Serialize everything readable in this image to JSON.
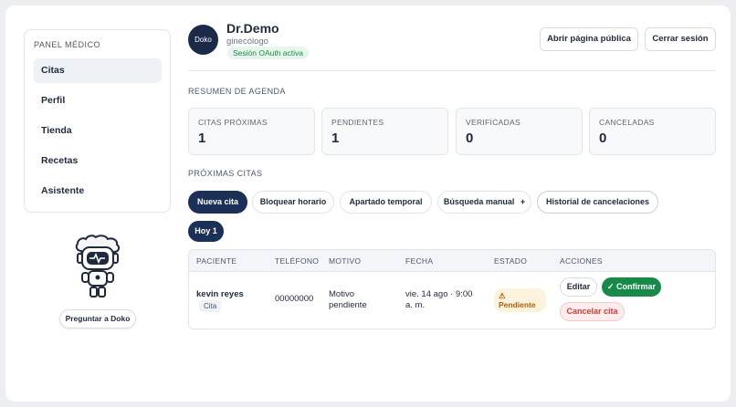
{
  "sidebar": {
    "title": "PANEL MÉDICO",
    "items": [
      {
        "label": "Citas",
        "active": true
      },
      {
        "label": "Perfil"
      },
      {
        "label": "Tienda"
      },
      {
        "label": "Recetas"
      },
      {
        "label": "Asistente"
      }
    ],
    "assistant_button": "Preguntar a Doko"
  },
  "header": {
    "avatar_text": "Doko",
    "doctor_name": "Dr.Demo",
    "specialty": "ginecólogo",
    "session_badge": "Sesión OAuth activa",
    "open_public_label": "Abrir página pública",
    "logout_label": "Cerrar sesión"
  },
  "summary": {
    "section_title": "RESUMEN DE AGENDA",
    "stats": [
      {
        "label": "CITAS PRÓXIMAS",
        "value": "1"
      },
      {
        "label": "PENDIENTES",
        "value": "1"
      },
      {
        "label": "VERIFICADAS",
        "value": "0"
      },
      {
        "label": "CANCELADAS",
        "value": "0"
      }
    ]
  },
  "upcoming": {
    "section_title": "PRÓXIMAS CITAS",
    "actions": {
      "new": "Nueva cita",
      "block": "Bloquear horario",
      "temp": "Apartado temporal",
      "search": "Búsqueda manual",
      "search_icon": "+",
      "history": "Historial de cancelaciones"
    },
    "filter_today": "Hoy 1",
    "table": {
      "headers": [
        "PACIENTE",
        "TELÉFONO",
        "MOTIVO",
        "FECHA",
        "ESTADO",
        "ACCIONES"
      ],
      "rows": [
        {
          "patient": "kevin reyes",
          "patient_tag": "Cita",
          "phone": "00000000",
          "reason_line1": "Motivo",
          "reason_line2": "pendiente",
          "date_line1": "vie. 14 ago · 9:00",
          "date_line2": "a. m.",
          "status_icon": "⚠",
          "status": "Pendiente",
          "edit_label": "Editar",
          "confirm_icon": "✓",
          "confirm_label": "Confirmar",
          "cancel_label": "Cancelar cita"
        }
      ]
    }
  },
  "colors": {
    "primary_dark": "#1b3057",
    "confirm_green": "#178a4a",
    "pending_bg": "#fdf3dc",
    "cancel_red": "#d33a3a"
  }
}
